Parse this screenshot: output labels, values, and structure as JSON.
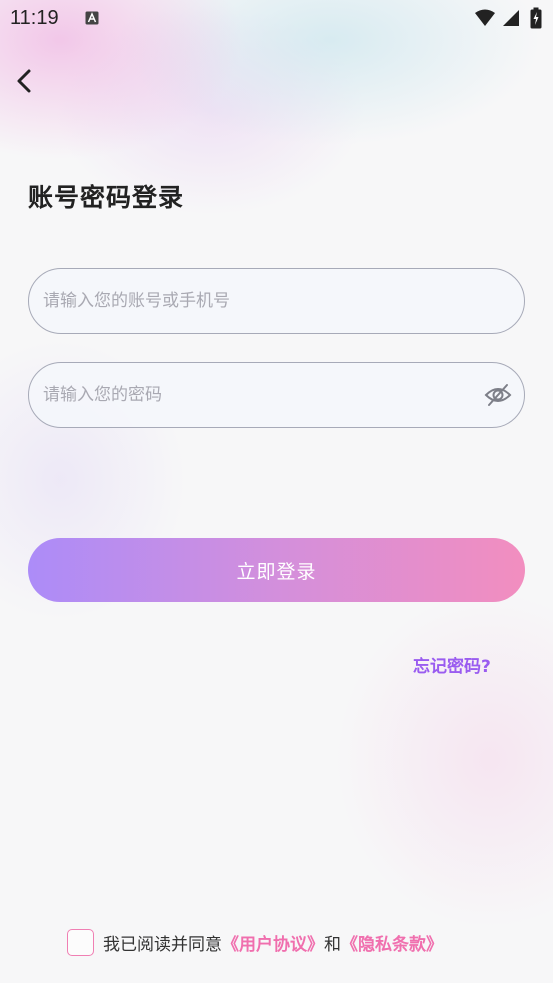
{
  "status_bar": {
    "time": "11:19",
    "notification_icon": "a-letter-icon",
    "wifi_icon": "wifi-icon",
    "signal_icon": "signal-icon",
    "battery_icon": "battery-charging-icon"
  },
  "header": {
    "back_icon": "chevron-left-icon",
    "title": "账号密码登录"
  },
  "form": {
    "account_placeholder": "请输入您的账号或手机号",
    "account_value": "",
    "password_placeholder": "请输入您的密码",
    "password_value": "",
    "password_toggle_icon": "eye-off-icon",
    "login_label": "立即登录",
    "forgot_label": "忘记密码?"
  },
  "agreement": {
    "checked": false,
    "prefix": "我已阅读并同意",
    "user_agreement": "《用户协议》",
    "conjunction": "和",
    "privacy_policy": "《隐私条款》"
  },
  "colors": {
    "accent_purple": "#9a5cf0",
    "link_pink": "#f06fae",
    "button_gradient_start": "#ac8cf8",
    "button_gradient_end": "#f28ebf"
  }
}
